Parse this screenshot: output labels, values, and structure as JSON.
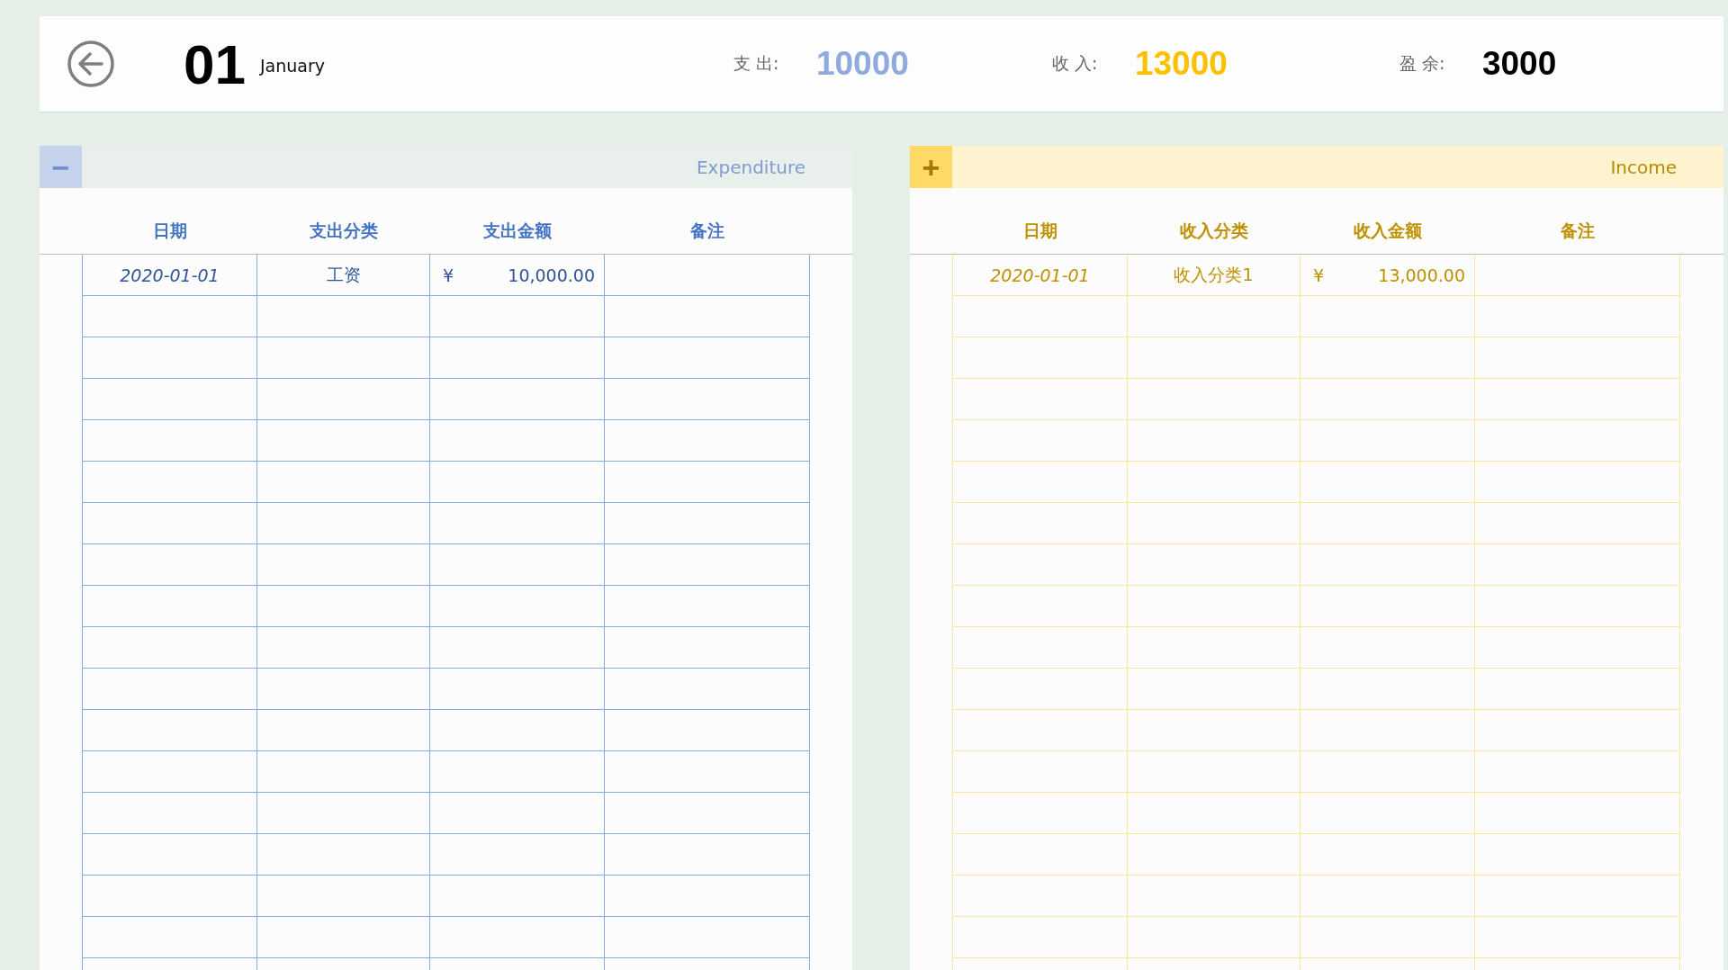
{
  "header": {
    "day": "01",
    "month": "January",
    "stats": [
      {
        "kind": "expense",
        "label": "支 出:",
        "value": "10000"
      },
      {
        "kind": "income",
        "label": "收 入:",
        "value": "13000"
      },
      {
        "kind": "surplus",
        "label": "盈 余:",
        "value": "3000"
      }
    ]
  },
  "panels": [
    {
      "kind": "expense",
      "button": "−",
      "title": "Expenditure",
      "columns": [
        "日期",
        "支出分类",
        "支出金额",
        "备注"
      ],
      "rows": [
        {
          "date": "2020-01-01",
          "category": "工资",
          "currency": "¥",
          "amount": "10,000.00"
        }
      ]
    },
    {
      "kind": "income",
      "button": "+",
      "title": "Income",
      "columns": [
        "日期",
        "收入分类",
        "收入金额",
        "备注"
      ],
      "rows": [
        {
          "date": "2020-01-01",
          "category": "收入分类1",
          "currency": "¥",
          "amount": "13,000.00"
        }
      ]
    }
  ]
}
